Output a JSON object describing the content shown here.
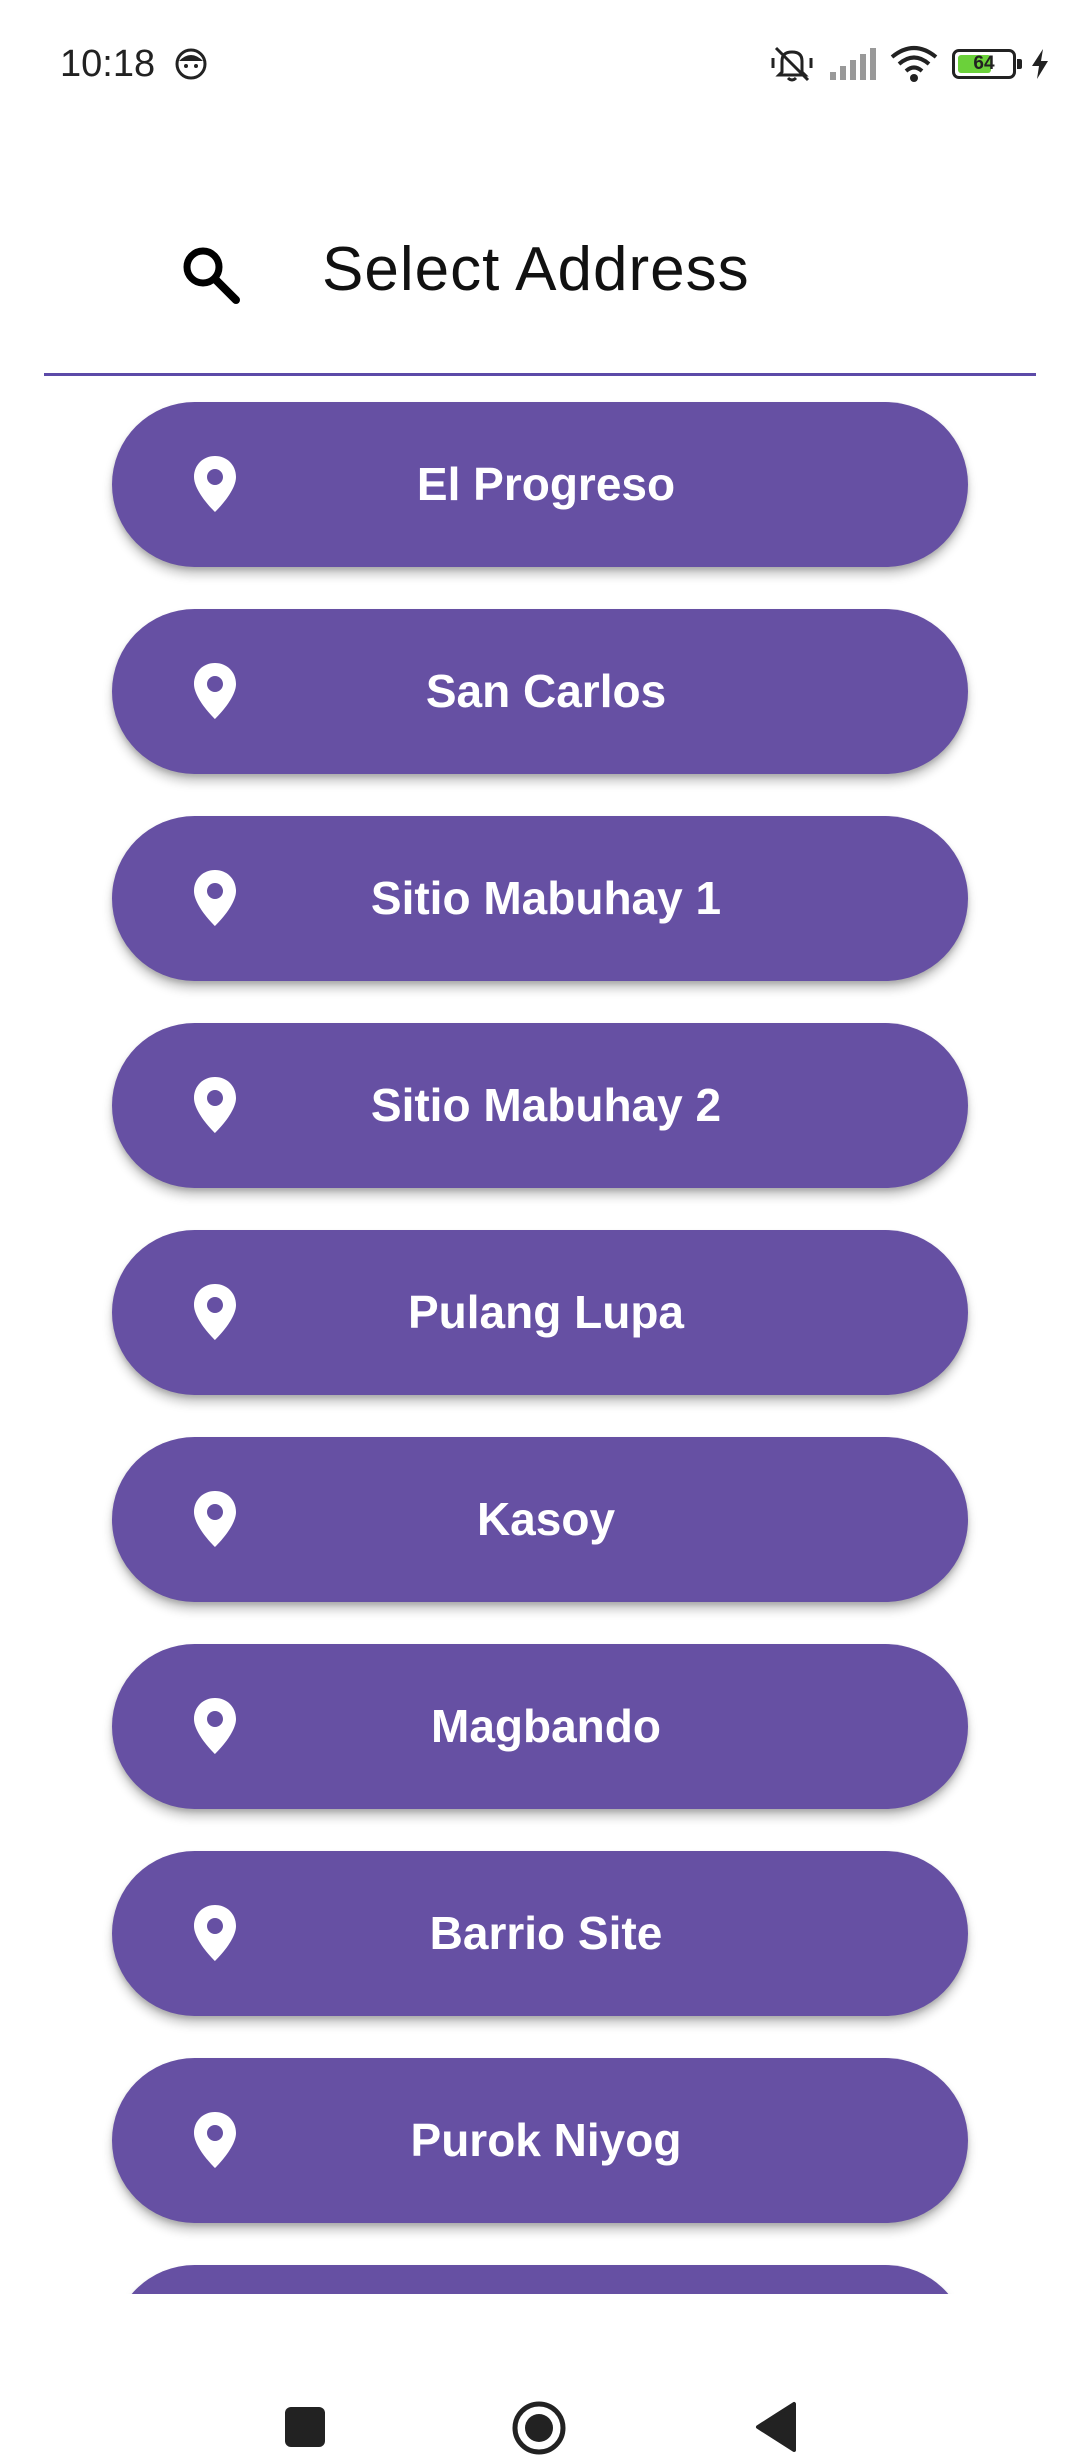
{
  "status_bar": {
    "time": "10:18",
    "battery_level": "64",
    "battery_fraction": 0.64,
    "icons": [
      "face-icon",
      "vibrate-silent-icon",
      "cell-signal-icon",
      "wifi-icon",
      "battery-icon",
      "charging-bolt-icon"
    ]
  },
  "header": {
    "search_icon": "search-icon",
    "title": "Select Address"
  },
  "addresses": [
    {
      "label": "El Progreso",
      "icon": "location-pin-icon"
    },
    {
      "label": "San Carlos",
      "icon": "location-pin-icon"
    },
    {
      "label": "Sitio Mabuhay 1",
      "icon": "location-pin-icon"
    },
    {
      "label": "Sitio Mabuhay 2",
      "icon": "location-pin-icon"
    },
    {
      "label": "Pulang Lupa",
      "icon": "location-pin-icon"
    },
    {
      "label": "Kasoy",
      "icon": "location-pin-icon"
    },
    {
      "label": "Magbando",
      "icon": "location-pin-icon"
    },
    {
      "label": "Barrio Site",
      "icon": "location-pin-icon"
    },
    {
      "label": "Purok Niyog",
      "icon": "location-pin-icon"
    },
    {
      "label": "",
      "icon": "location-pin-icon"
    }
  ],
  "nav_bar": {
    "icons": [
      "recents-square-icon",
      "home-circle-icon",
      "back-triangle-icon"
    ]
  },
  "colors": {
    "accent": "#6650a3",
    "divider": "#5c4aa8",
    "button_text": "#ffffff",
    "battery_fill": "#6bd13a"
  }
}
